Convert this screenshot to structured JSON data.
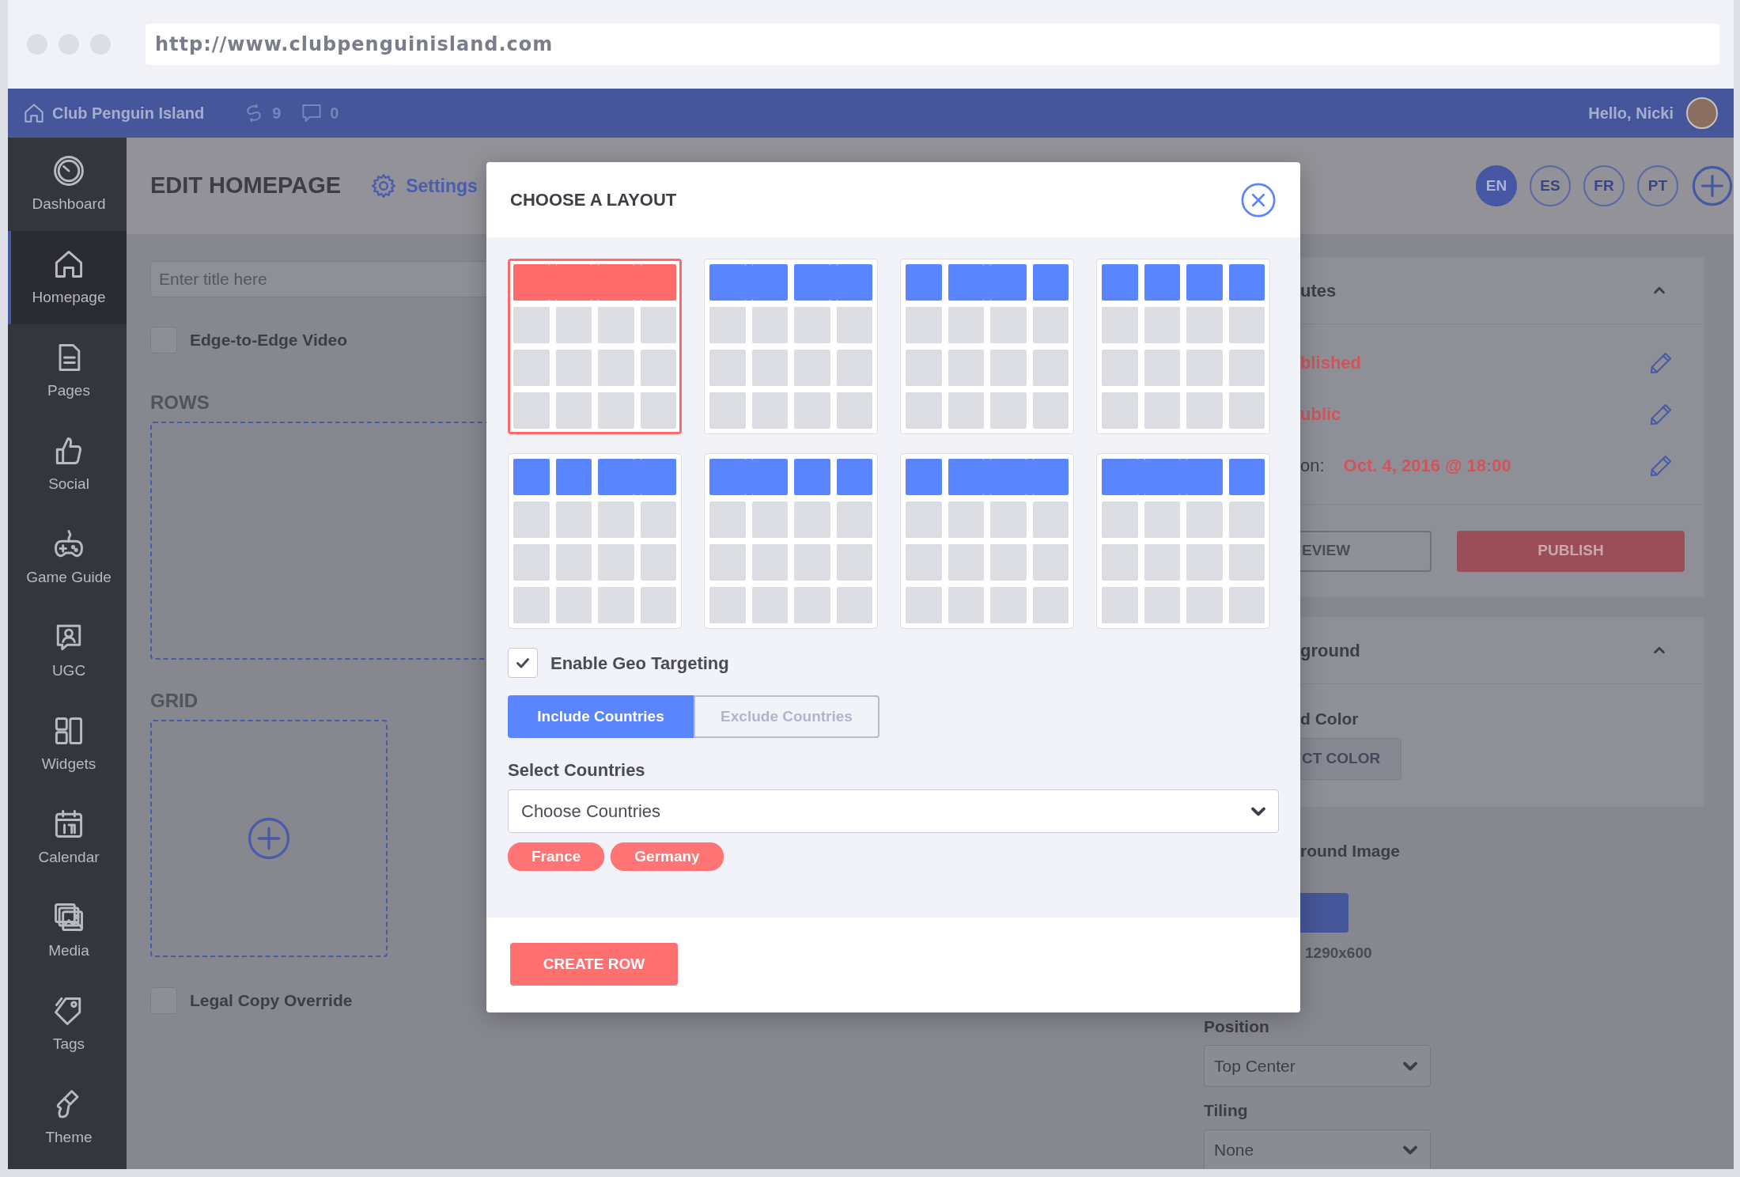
{
  "browser": {
    "url": "http://www.clubpenguinisland.com"
  },
  "topbar": {
    "site": "Club Penguin Island",
    "counters": [
      {
        "kind": "shares",
        "count": "9"
      },
      {
        "kind": "comments",
        "count": "0"
      }
    ],
    "greeting": "Hello, Nicki"
  },
  "sidebar": {
    "items": [
      {
        "label": "Dashboard",
        "selected": false
      },
      {
        "label": "Homepage",
        "selected": true
      },
      {
        "label": "Pages",
        "selected": false
      },
      {
        "label": "Social",
        "selected": false
      },
      {
        "label": "Game Guide",
        "selected": false
      },
      {
        "label": "UGC",
        "selected": false
      },
      {
        "label": "Widgets",
        "selected": false
      },
      {
        "label": "Calendar",
        "selected": false
      },
      {
        "label": "Media",
        "selected": false
      },
      {
        "label": "Tags",
        "selected": false
      },
      {
        "label": "Theme",
        "selected": false
      }
    ]
  },
  "page": {
    "title": "EDIT HOMEPAGE",
    "settings": "Settings",
    "languages": [
      {
        "code": "EN",
        "selected": true
      },
      {
        "code": "ES",
        "selected": false
      },
      {
        "code": "FR",
        "selected": false
      },
      {
        "code": "PT",
        "selected": false
      }
    ],
    "title_field": {
      "placeholder": "Enter title here"
    },
    "edge_video": {
      "label": "Edge-to-Edge Video",
      "checked": false
    },
    "rows_heading": "ROWS",
    "grid_heading": "GRID",
    "legal_copy": {
      "label": "Legal Copy Override",
      "checked": false
    }
  },
  "right_panel": {
    "attributes": {
      "title": "utes",
      "expanded": true,
      "rows": [
        {
          "text": "blished"
        },
        {
          "text": "ublic"
        },
        {
          "label": "on:",
          "text": "Oct. 4, 2016 @ 18:00"
        }
      ],
      "preview_button": "EVIEW",
      "publish_button": "PUBLISH"
    },
    "background": {
      "title": "ground",
      "expanded": true,
      "color_label": "d Color",
      "color_button": "CT COLOR"
    },
    "image": {
      "label": "round Image",
      "size": "1290x600",
      "position": {
        "label": "Position",
        "value": "Top Center"
      },
      "tiling": {
        "label": "Tiling",
        "value": "None"
      }
    }
  },
  "modal": {
    "title": "CHOOSE A LAYOUT",
    "layouts": [
      {
        "top_row": [
          {
            "joined": true
          },
          {
            "joined": true
          },
          {
            "joined": true
          }
        ],
        "selected": true
      },
      {
        "top_row": [
          {
            "joined": true
          },
          {
            "joined": false
          },
          {
            "joined": true
          }
        ],
        "selected": false
      },
      {
        "top_row": [
          {
            "joined": false
          },
          {
            "joined": true
          },
          {
            "joined": false
          }
        ],
        "selected": false
      },
      {
        "top_row": [
          {
            "joined": false
          },
          {
            "joined": false
          },
          {
            "joined": false
          }
        ],
        "selected": false
      },
      {
        "top_row": [
          {
            "joined": false
          },
          {
            "joined": false
          },
          {
            "joined": true
          }
        ],
        "selected": false
      },
      {
        "top_row": [
          {
            "joined": true
          },
          {
            "joined": false
          },
          {
            "joined": false
          }
        ],
        "selected": false
      },
      {
        "top_row": [
          {
            "joined": false
          },
          {
            "joined": true
          },
          {
            "joined": true
          }
        ],
        "selected": false
      },
      {
        "top_row": [
          {
            "joined": true
          },
          {
            "joined": true
          },
          {
            "joined": false
          }
        ],
        "selected": false
      }
    ],
    "geo_targeting": {
      "label": "Enable Geo Targeting",
      "checked": true
    },
    "modes": [
      {
        "label": "Include Countries",
        "selected": true
      },
      {
        "label": "Exclude Countries",
        "selected": false
      }
    ],
    "countries_label": "Select Countries",
    "countries_select": {
      "placeholder": "Choose Countries"
    },
    "tags": [
      "France",
      "Germany"
    ],
    "submit": "CREATE ROW"
  }
}
